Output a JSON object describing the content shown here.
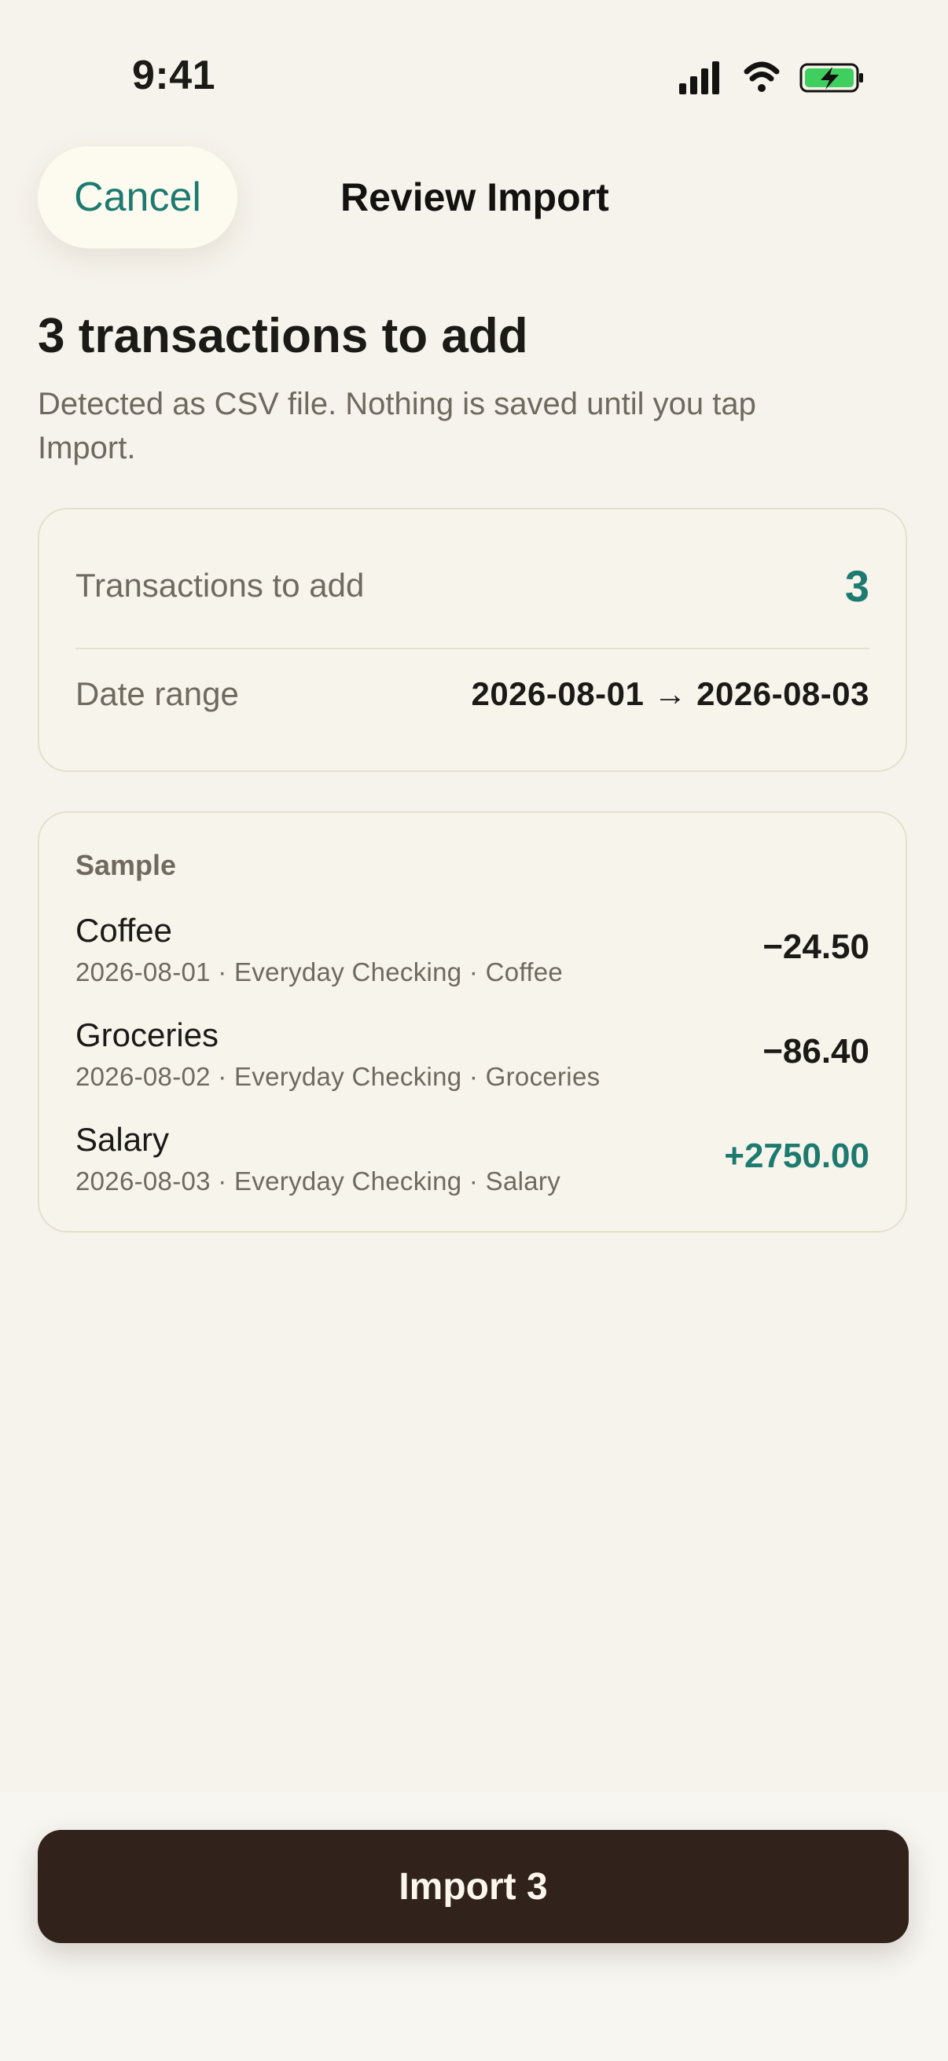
{
  "status_bar": {
    "time": "9:41",
    "icons": [
      "cellular-signal-icon",
      "wifi-icon",
      "battery-charging-icon"
    ],
    "battery_color": "#3fcf5f"
  },
  "nav": {
    "cancel_label": "Cancel",
    "title": "Review Import"
  },
  "header": {
    "heading": "3 transactions to add",
    "subtitle": "Detected as CSV file. Nothing is saved until you tap Import."
  },
  "summary": {
    "count_label": "Transactions to add",
    "count_value": "3",
    "range_label": "Date range",
    "range_value": "2026-08-01 → 2026-08-03"
  },
  "sample": {
    "title": "Sample",
    "transactions": [
      {
        "name": "Coffee",
        "meta": "2026-08-01 · Everyday Checking · Coffee",
        "amount": "−24.50",
        "direction": "debit"
      },
      {
        "name": "Groceries",
        "meta": "2026-08-02 · Everyday Checking · Groceries",
        "amount": "−86.40",
        "direction": "debit"
      },
      {
        "name": "Salary",
        "meta": "2026-08-03 · Everyday Checking · Salary",
        "amount": "+2750.00",
        "direction": "credit"
      }
    ]
  },
  "footer": {
    "import_label": "Import 3"
  },
  "colors": {
    "accent": "#1d7a70",
    "background": "#f6f3ec",
    "primary_button": "#31231c"
  }
}
